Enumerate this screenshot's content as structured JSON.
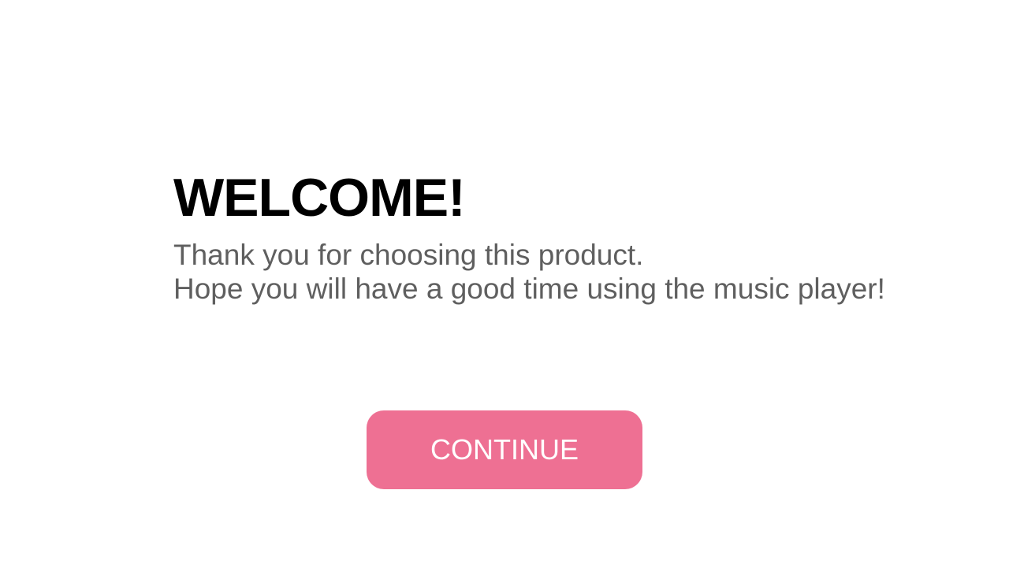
{
  "welcome": {
    "title": "WELCOME!",
    "message_line_1": "Thank you for choosing this product.",
    "message_line_2": "Hope you will have a good time using the music player!"
  },
  "actions": {
    "continue_label": "CONTINUE"
  },
  "colors": {
    "background": "#ffffff",
    "title": "#000000",
    "message": "#5f5f5f",
    "continue_button": "#ee7093",
    "continue_text": "#ffffff"
  }
}
